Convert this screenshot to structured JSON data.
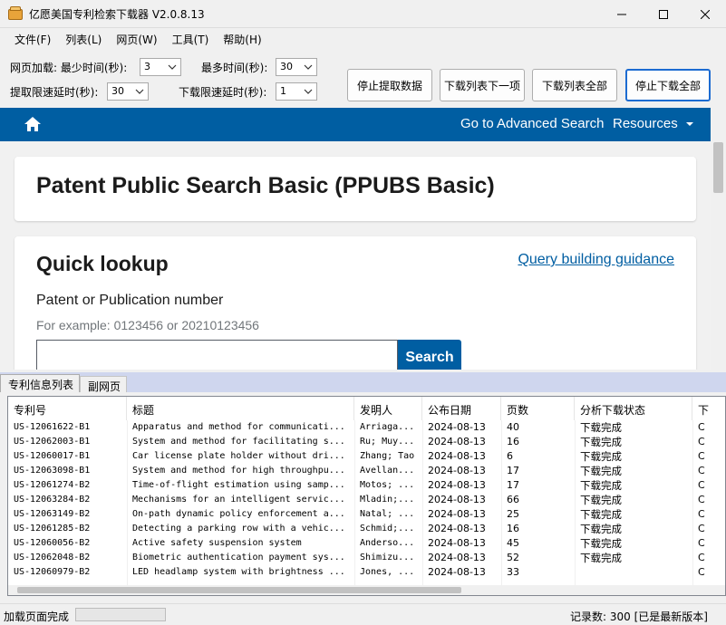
{
  "window": {
    "title": "亿愿美国专利检索下载器 V2.0.8.13"
  },
  "menu": [
    "文件(F)",
    "列表(L)",
    "网页(W)",
    "工具(T)",
    "帮助(H)"
  ],
  "toolbar": {
    "page_load_label": "网页加载: 最少时间(秒):",
    "min_time": "3",
    "max_time_label": "最多时间(秒):",
    "max_time": "30",
    "extract_delay_label": "提取限速延时(秒):",
    "extract_delay": "30",
    "download_delay_label": "下载限速延时(秒):",
    "download_delay": "1",
    "buttons": {
      "stop_extract": "停止提取数据",
      "download_next": "下载列表下一项",
      "download_all": "下载列表全部",
      "stop_download": "停止下载全部"
    }
  },
  "web": {
    "nav": {
      "advanced": "Go to Advanced Search",
      "resources": "Resources"
    },
    "page_title": "Patent Public Search Basic (PPUBS Basic)",
    "quick_lookup": "Quick lookup",
    "guidance_link": "Query building guidance",
    "field_label": "Patent or Publication number",
    "hint": "For example: 0123456 or 20210123456",
    "search_button": "Search",
    "input_value": ""
  },
  "tabs": {
    "patent_list": "专利信息列表",
    "sub_page": "副网页"
  },
  "table": {
    "columns": [
      "专利号",
      "标题",
      "发明人",
      "公布日期",
      "页数",
      "分析下载状态",
      "下"
    ],
    "rows": [
      [
        "US-12061622-B1",
        "Apparatus and method for communicati...",
        "Arriaga...",
        "2024-08-13",
        "40",
        "下载完成",
        "C"
      ],
      [
        "US-12062003-B1",
        "System and method for facilitating s...",
        "Ru; Muy...",
        "2024-08-13",
        "16",
        "下载完成",
        "C"
      ],
      [
        "US-12060017-B1",
        "Car license plate holder without dri...",
        "Zhang; Tao",
        "2024-08-13",
        "6",
        "下载完成",
        "C"
      ],
      [
        "US-12063098-B1",
        "System and method for high throughpu...",
        "Avellan...",
        "2024-08-13",
        "17",
        "下载完成",
        "C"
      ],
      [
        "US-12061274-B2",
        "Time-of-flight estimation using samp...",
        "Motos; ...",
        "2024-08-13",
        "17",
        "下载完成",
        "C"
      ],
      [
        "US-12063284-B2",
        "Mechanisms for an intelligent servic...",
        "Mladin;...",
        "2024-08-13",
        "66",
        "下载完成",
        "C"
      ],
      [
        "US-12063149-B2",
        "On-path dynamic policy enforcement a...",
        "Natal; ...",
        "2024-08-13",
        "25",
        "下载完成",
        "C"
      ],
      [
        "US-12061285-B2",
        "Detecting a parking row with a vehic...",
        "Schmid;...",
        "2024-08-13",
        "16",
        "下载完成",
        "C"
      ],
      [
        "US-12060056-B2",
        "Active safety suspension system",
        "Anderso...",
        "2024-08-13",
        "45",
        "下载完成",
        "C"
      ],
      [
        "US-12062048-B2",
        "Biometric authentication payment sys...",
        "Shimizu...",
        "2024-08-13",
        "52",
        "下载完成",
        "C"
      ],
      [
        "US-12060979-B2",
        "LED headlamp system with brightness ...",
        "Jones, ...",
        "2024-08-13",
        "33",
        "",
        "C"
      ]
    ]
  },
  "status": {
    "text": "加载页面完成",
    "progress": 0,
    "records": "记录数: 300  [已是最新版本]"
  }
}
